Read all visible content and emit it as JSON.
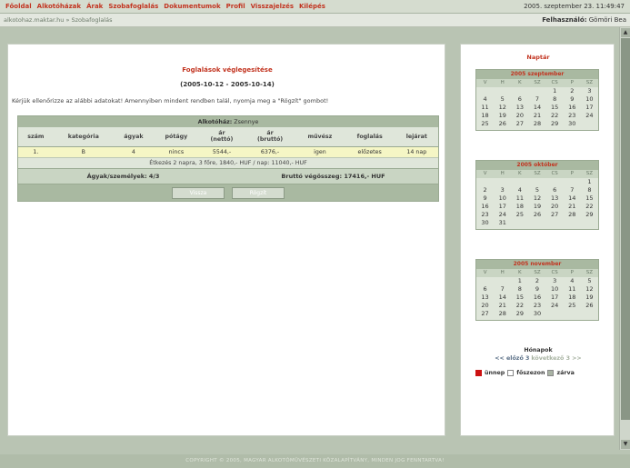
{
  "menu": [
    "Főoldal",
    "Alkotóházak",
    "Árak",
    "Szobafoglalás",
    "Dokumentumok",
    "Profil",
    "Visszajelzés",
    "Kilépés"
  ],
  "datetime": "2005. szeptember 23. 11:49:47",
  "breadcrumb": "alkotohaz.maktar.hu » Szobafoglalás",
  "user": {
    "label": "Felhasználó:",
    "name": "Gömöri Bea"
  },
  "booking": {
    "title": "Foglalások véglegesítése",
    "daterange": "(2005-10-12 - 2005-10-14)",
    "instruction": "Kérjük ellenőrizze az alábbi adatokat! Amennyiben mindent rendben talál, nyomja meg a \"Rögzít\" gombot!",
    "house_label": "Alkotóház:",
    "house_value": "Zsennye",
    "columns": [
      "szám",
      "kategória",
      "ágyak",
      "pótágy",
      "ár\n(nettó)",
      "ár\n(bruttó)",
      "művész",
      "foglalás",
      "lejárat"
    ],
    "rows": [
      [
        "1.",
        "B",
        "4",
        "nincs",
        "5544,-",
        "6376,-",
        "igen",
        "előzetes",
        "14 nap"
      ]
    ],
    "meals": "Étkezés 2 napra, 3 főre, 1840,- HUF / nap: 11040,- HUF",
    "beds_persons": "Ágyak/személyek: 4/3",
    "total": "Bruttó végösszeg: 17416,- HUF",
    "back_button": "Vissza",
    "save_button": "Rögzít"
  },
  "sidebar": {
    "title": "Naptár",
    "dow": [
      "V",
      "H",
      "K",
      "SZ",
      "CS",
      "P",
      "SZ"
    ],
    "calendars": [
      {
        "title": "2005 szeptember",
        "offset": 4,
        "days": 30
      },
      {
        "title": "2005 október",
        "offset": 6,
        "days": 31
      },
      {
        "title": "2005 november",
        "offset": 2,
        "days": 30
      }
    ],
    "months_label": "Hónapok",
    "nav_prev": "<< előző 3",
    "nav_next": "következő 3 >>",
    "legend": {
      "holiday": "ünnep",
      "high_season": "főszezon",
      "closed": "zárva"
    }
  },
  "footer": "COPYRIGHT © 2005, MAGYAR ALKOTÓMŰVÉSZETI KÖZALAPÍTVÁNY, MINDEN JOG FENNTARTVA!",
  "colors": {
    "accent": "#c2331f",
    "header_bg": "#a9b9a1",
    "row_highlight": "#f5f6c5"
  }
}
